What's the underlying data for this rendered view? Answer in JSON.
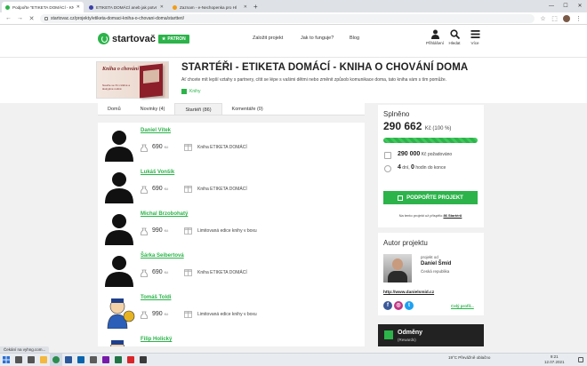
{
  "browser": {
    "tabs": [
      {
        "title": "Podpořte \"ETIKETA DOMÁCÍ - KN",
        "color": "#2cb34a",
        "active": true
      },
      {
        "title": "ETIKETA DOMÁCÍ aneb jak potvr",
        "color": "#3b3fa8",
        "active": false
      },
      {
        "title": "Zaznam - e-Nechopenka pro Hl",
        "color": "#f39c12",
        "active": false
      }
    ],
    "new_tab": "+",
    "url": "startovac.cz/projekty/etiketa-domaci-kniha-o-chovani-doma/startteri/",
    "window_controls": [
      "—",
      "☐",
      "✕"
    ]
  },
  "site": {
    "logo": "startovač",
    "patron": "PATRON",
    "nav": [
      "Založit projekt",
      "Jak to funguje?",
      "Blog"
    ],
    "icons": [
      {
        "name": "user",
        "label": "Přihlášení"
      },
      {
        "name": "search",
        "label": "Hledat"
      },
      {
        "name": "menu",
        "label": "Více"
      }
    ]
  },
  "project": {
    "image_text_title": "Kniha o chování doma.",
    "image_text_sub": "Naučte se žít v klidné a láskyplné rodině",
    "title": "STARTÉŘI - ETIKETA DOMÁCÍ - KNIHA O CHOVÁNÍ DOMA",
    "subtitle": "Ať chcete mít lepší vztahy s partnery, cítit se lépe s vašimi dětmi nebo změnit způsob komunikace doma, tato kniha vám s tím pomůže.",
    "category": "Knihy",
    "tabs": [
      "Domů",
      "Novinky (4)",
      "Startéři (86)",
      "Komentáře (0)"
    ],
    "active_tab": 2
  },
  "backers": [
    {
      "name": "Daniel Vítek",
      "amount": "690",
      "currency": "Kč",
      "reward": "Kniha ETIKETA DOMÁCÍ",
      "avatar": "silhouette"
    },
    {
      "name": "Lukáš Vonšík",
      "amount": "690",
      "currency": "Kč",
      "reward": "Kniha ETIKETA DOMÁCÍ",
      "avatar": "silhouette"
    },
    {
      "name": "Michal Brzobohatý",
      "amount": "990",
      "currency": "Kč",
      "reward": "Limitovaná edice knihy v boxu",
      "avatar": "silhouette"
    },
    {
      "name": "Šárka Seibertová",
      "amount": "690",
      "currency": "Kč",
      "reward": "Kniha ETIKETA DOMÁCÍ",
      "avatar": "silhouette"
    },
    {
      "name": "Tomáš Toldi",
      "amount": "990",
      "currency": "Kč",
      "reward": "Limitovaná edice knihy v boxu",
      "avatar": "cartoon"
    },
    {
      "name": "Filip Holický",
      "amount": "",
      "currency": "",
      "reward": "",
      "avatar": "cartoon"
    }
  ],
  "funding": {
    "label": "Splněno",
    "raised": "290 662",
    "unit_pct": "Kč (100 %)",
    "progress": 1.0,
    "goal_value": "290 000",
    "goal_unit": "Kč",
    "goal_label": "požadováno",
    "days": "4",
    "days_unit": "dní,",
    "hours": "0",
    "hours_label": "hodin do konce",
    "support_button": "PODPOŘTE PROJEKT",
    "backers_note_prefix": "Na tento projekt už přispělo",
    "backers_count": "86 Startérů"
  },
  "author": {
    "heading": "Autor projektu",
    "project_by": "projekt od",
    "name": "Daniel Šmíd",
    "country": "Česká republika",
    "url": "http://www.danielsmid.cz",
    "profile_link": "Celý profil...",
    "socials": [
      {
        "name": "facebook",
        "glyph": "f",
        "color": "#3b5998"
      },
      {
        "name": "instagram",
        "glyph": "◎",
        "color": "#c13584"
      },
      {
        "name": "twitter",
        "glyph": "t",
        "color": "#1da1f2"
      }
    ]
  },
  "rewards": {
    "title": "Odměny",
    "sub": "(Rewards)"
  },
  "status_bar": "Čekání na vyhng.com...",
  "taskbar": {
    "apps": [
      {
        "name": "search",
        "color": "#555"
      },
      {
        "name": "task-view",
        "color": "#555"
      },
      {
        "name": "explorer",
        "color": "#f3b83d"
      },
      {
        "name": "chrome",
        "color": "#2c8c4e"
      },
      {
        "name": "word",
        "color": "#2b579a"
      },
      {
        "name": "outlook",
        "color": "#0a64ad"
      },
      {
        "name": "photos",
        "color": "#5c5c5c"
      },
      {
        "name": "onenote",
        "color": "#7719aa"
      },
      {
        "name": "excel",
        "color": "#217346"
      },
      {
        "name": "acrobat",
        "color": "#d9262b"
      },
      {
        "name": "media",
        "color": "#3b3b3b"
      }
    ],
    "weather": "19°C  Převážně oblačno",
    "time": "9:21",
    "date": "12.07.2021"
  }
}
